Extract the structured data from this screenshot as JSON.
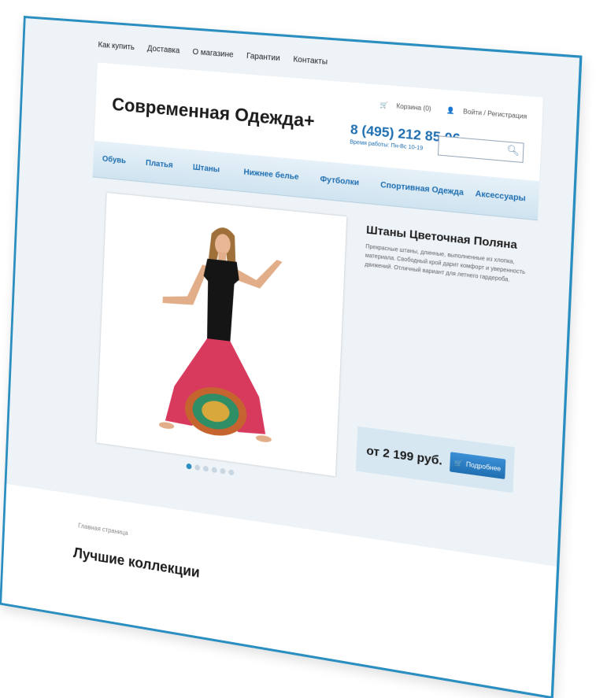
{
  "top_menu": [
    "Как купить",
    "Доставка",
    "О магазине",
    "Гарантии",
    "Контакты"
  ],
  "header": {
    "logo": "Современная Одежда+",
    "cart": "Корзина (0)",
    "login": "Войти / Регистрация",
    "phone": "8 (495) 212 85 06",
    "hours": "Время работы: Пн-Вс 10-19",
    "search_placeholder": ""
  },
  "nav": [
    "Обувь",
    "Платья",
    "Штаны",
    "Нижнее белье",
    "Футболки",
    "Спортивная Одежда",
    "Аксессуары"
  ],
  "product": {
    "title": "Штаны Цветочная Поляна",
    "description": "Прекрасные штаны, длинные, выполненные из хлопка, материала. Свободный крой дарит комфорт и уверенность движений. Отличный вариант для летнего гардероба.",
    "price": "от 2 199 руб.",
    "button": "Подробнее"
  },
  "slider": {
    "count": 6,
    "active": 0
  },
  "lower": {
    "breadcrumb": "Главная страница",
    "section_title": "Лучшие коллекции"
  },
  "colors": {
    "accent": "#1f6fb1",
    "border": "#2a8fc0",
    "background": "#eef3f7"
  }
}
